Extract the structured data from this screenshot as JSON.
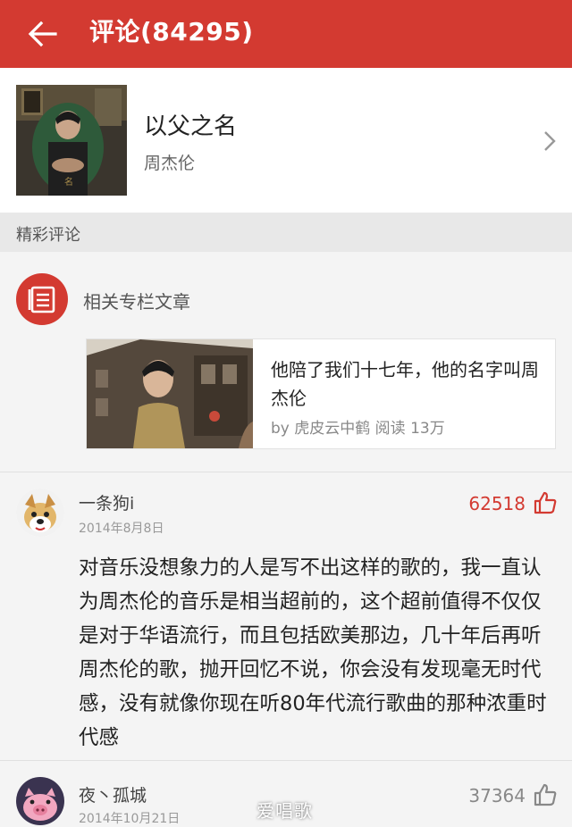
{
  "header": {
    "title": "评论(84295)",
    "back_icon": "arrow-left-icon"
  },
  "song": {
    "name": "以父之名",
    "artist": "周杰伦"
  },
  "section": {
    "label": "精彩评论"
  },
  "related": {
    "label": "相关专栏文章",
    "article": {
      "title": "他陪了我们十七年，他的名字叫周杰伦",
      "meta": "by 虎皮云中鹤  阅读 13万"
    }
  },
  "comments": [
    {
      "user": "一条狗i",
      "date": "2014年8月8日",
      "likes": "62518",
      "liked": true,
      "text": "对音乐没想象力的人是写不出这样的歌的，我一直认为周杰伦的音乐是相当超前的，这个超前值得不仅仅是对于华语流行，而且包括欧美那边，几十年后再听周杰伦的歌，抛开回忆不说，你会没有发现毫无时代感，没有就像你现在听80年代流行歌曲的那种浓重时代感"
    },
    {
      "user": "夜丶孤城",
      "date": "2014年10月21日",
      "likes": "37364",
      "liked": false
    }
  ],
  "watermark": "爱唱歌",
  "colors": {
    "accent": "#d33a31",
    "liked": "#d33a31",
    "muted": "#888888"
  }
}
